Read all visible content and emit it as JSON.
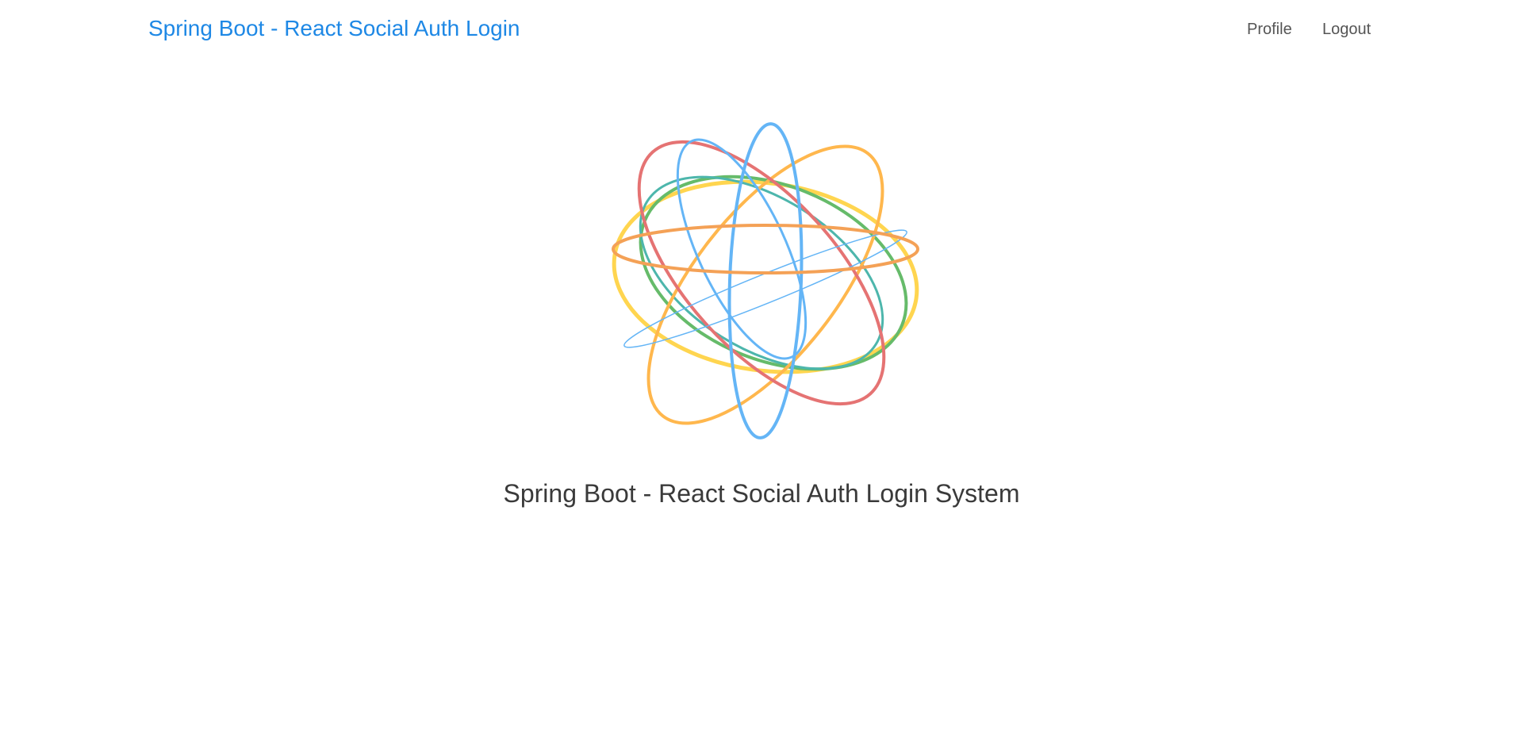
{
  "header": {
    "app_title": "Spring Boot - React Social Auth Login",
    "nav": {
      "profile_label": "Profile",
      "logout_label": "Logout"
    },
    "accent_color": "#1e88e5"
  },
  "main": {
    "logo_icon": "orbit-sphere-logo-icon",
    "logo_colors": [
      "#64b5f6",
      "#e57373",
      "#ffb74d",
      "#4db6ac",
      "#66bb6a",
      "#ffd54f",
      "#f4a156"
    ],
    "title": "Spring Boot - React Social Auth Login System"
  }
}
